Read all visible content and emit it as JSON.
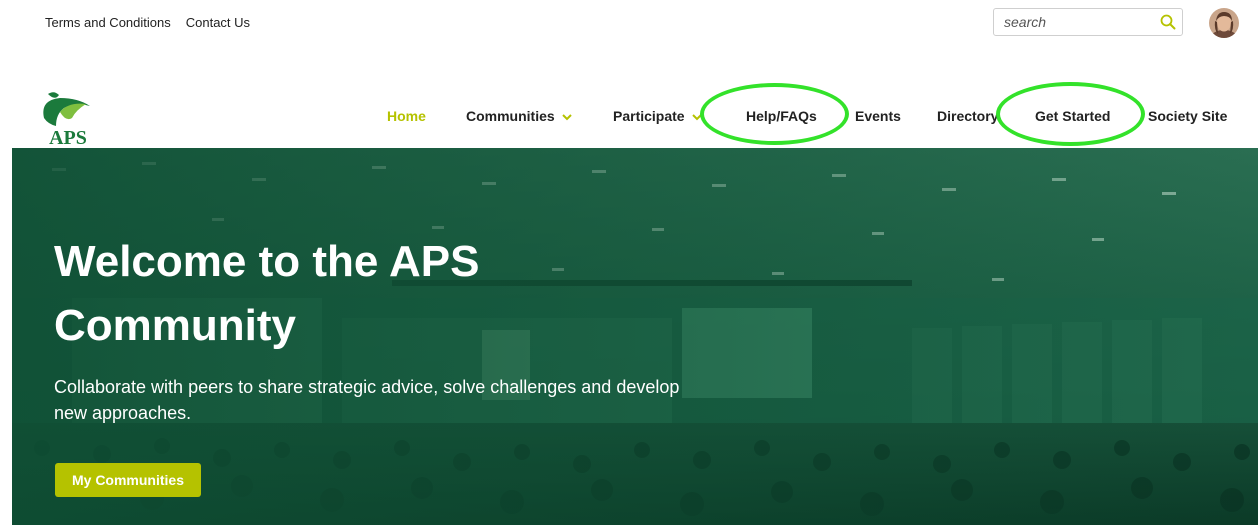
{
  "utility": {
    "links": [
      "Terms and Conditions",
      "Contact Us"
    ],
    "search_placeholder": "search"
  },
  "logo": {
    "text": "APS"
  },
  "nav": {
    "items": [
      "Home",
      "Communities",
      "Participate",
      "Help/FAQs",
      "Events",
      "Directory",
      "Get Started",
      "Society Site"
    ],
    "active": "Home",
    "highlighted": [
      "Help/FAQs",
      "Get Started"
    ]
  },
  "hero": {
    "title_line1": "Welcome to the APS",
    "title_line2": "Community",
    "subtitle_line1": "Collaborate with peers to share strategic advice, solve challenges and develop",
    "subtitle_line2": "new approaches.",
    "button_label": "My Communities"
  },
  "colors": {
    "accent": "#b5c200",
    "hero_overlay": "#13593d",
    "highlight_ring": "#33e22a"
  },
  "icons": [
    "search-icon",
    "chevron-down-icon",
    "aps-logo-icon"
  ]
}
